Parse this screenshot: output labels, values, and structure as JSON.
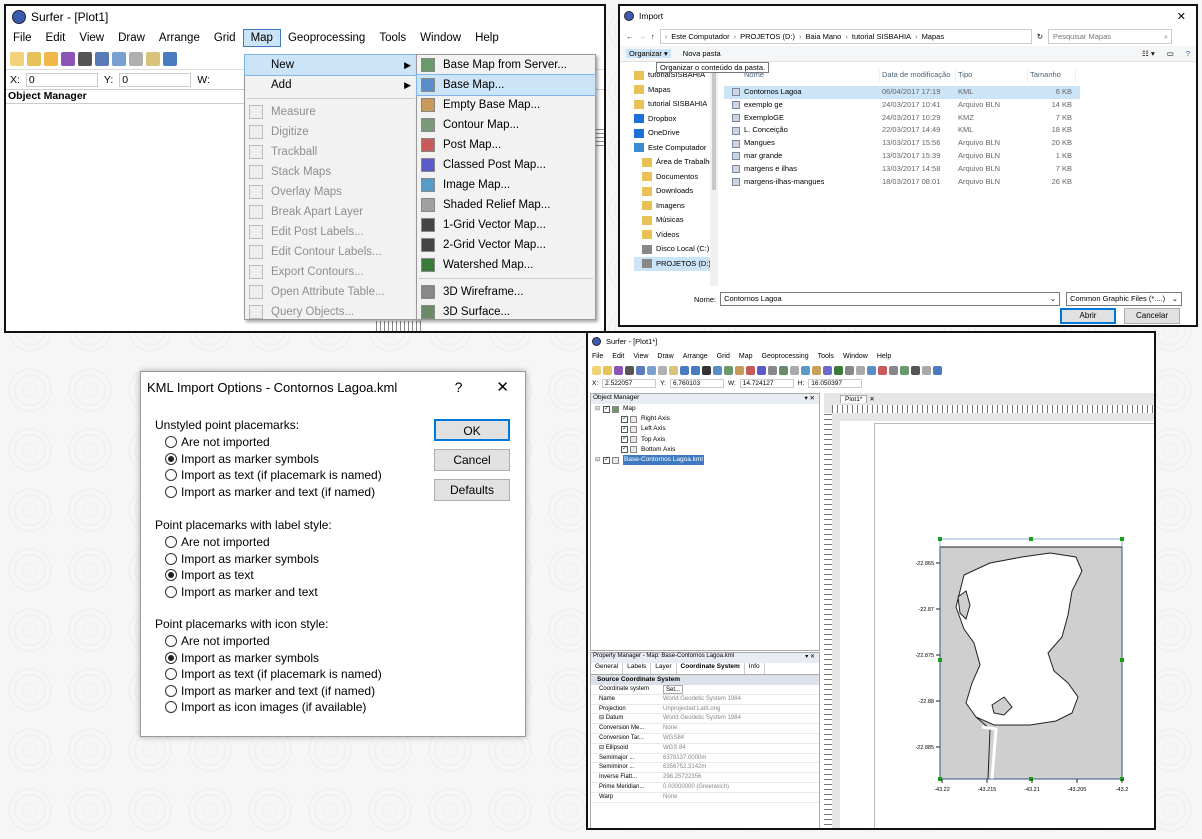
{
  "surfer_menu": {
    "title": "Surfer - [Plot1]",
    "menubar": [
      "File",
      "Edit",
      "View",
      "Draw",
      "Arrange",
      "Grid",
      "Map",
      "Geoprocessing",
      "Tools",
      "Window",
      "Help"
    ],
    "coords": {
      "x_label": "X:",
      "x_val": "0",
      "y_label": "Y:",
      "y_val": "0",
      "w_label": "W:"
    },
    "object_manager": "Object Manager",
    "map_menu": {
      "new": "New",
      "add": "Add",
      "items": [
        "Measure",
        "Digitize",
        "Trackball",
        "Stack Maps",
        "Overlay Maps",
        "Break Apart Layer",
        "Edit Post Labels...",
        "Edit Contour Labels...",
        "Export Contours...",
        "Open Attribute Table...",
        "Query Objects..."
      ]
    },
    "new_submenu": [
      "Base Map from Server...",
      "Base Map...",
      "Empty Base Map...",
      "Contour Map...",
      "Post Map...",
      "Classed Post Map...",
      "Image Map...",
      "Shaded Relief Map...",
      "1-Grid Vector Map...",
      "2-Grid Vector Map...",
      "Watershed Map...",
      "3D Wireframe...",
      "3D Surface..."
    ]
  },
  "import_dialog": {
    "title": "Import",
    "path": [
      "Este Computador",
      "PROJETOS (D:)",
      "Baia Mano",
      "tutorial SISBAHIA",
      "Mapas"
    ],
    "search_placeholder": "Pesquisar Mapas",
    "organize": "Organizar ▾",
    "new_folder": "Nova pasta",
    "tooltip": "Organizar o conteúdo da pasta.",
    "nav": [
      "tutorialSISBAHIA",
      "Mapas",
      "tutorial SISBAHIA",
      "Dropbox",
      "OneDrive",
      "Este Computador",
      "Área de Trabalho",
      "Documentos",
      "Downloads",
      "Imagens",
      "Músicas",
      "Vídeos",
      "Disco Local (C:)",
      "PROJETOS (D:)"
    ],
    "columns": [
      "Nome",
      "Data de modificação",
      "Tipo",
      "Tamanho"
    ],
    "files": [
      {
        "name": "Contornos Lagoa",
        "date": "06/04/2017 17:19",
        "type": "KML",
        "size": "6 KB"
      },
      {
        "name": "exemplo ge",
        "date": "24/03/2017 10:41",
        "type": "Arquivo BLN",
        "size": "14 KB"
      },
      {
        "name": "ExemploGE",
        "date": "24/03/2017 10:29",
        "type": "KMZ",
        "size": "7 KB"
      },
      {
        "name": "L. Conceição",
        "date": "22/03/2017 14:49",
        "type": "KML",
        "size": "18 KB"
      },
      {
        "name": "Mangues",
        "date": "13/03/2017 15:56",
        "type": "Arquivo BLN",
        "size": "20 KB"
      },
      {
        "name": "mar grande",
        "date": "13/03/2017 15:39",
        "type": "Arquivo BLN",
        "size": "1 KB"
      },
      {
        "name": "margens e ilhas",
        "date": "13/03/2017 14:58",
        "type": "Arquivo BLN",
        "size": "7 KB"
      },
      {
        "name": "margens-ilhas-mangues",
        "date": "18/03/2017 08:01",
        "type": "Arquivo BLN",
        "size": "26 KB"
      }
    ],
    "filename_label": "Nome:",
    "filename_value": "Contornos Lagoa",
    "filter": "Common Graphic Files (*....)",
    "open": "Abrir",
    "cancel": "Cancelar"
  },
  "kml_dialog": {
    "title": "KML Import Options - Contornos Lagoa.kml",
    "help": "?",
    "close": "✕",
    "ok": "OK",
    "cancel": "Cancel",
    "defaults": "Defaults",
    "groups": [
      {
        "label": "Unstyled point placemarks:",
        "options": [
          "Are not imported",
          "Import as marker symbols",
          "Import as text (if placemark is named)",
          "Import as marker and text (if named)"
        ],
        "selected": 1
      },
      {
        "label": "Point placemarks with label style:",
        "options": [
          "Are not imported",
          "Import as marker symbols",
          "Import as text",
          "Import as marker and text"
        ],
        "selected": 2
      },
      {
        "label": "Point placemarks with icon style:",
        "options": [
          "Are not imported",
          "Import as marker symbols",
          "Import as text (if placemark is named)",
          "Import as marker and text (if named)",
          "Import as icon images (if available)"
        ],
        "selected": 1
      }
    ]
  },
  "surfer_result": {
    "title": "Surfer - [Plot1*]",
    "menubar": [
      "File",
      "Edit",
      "View",
      "Draw",
      "Arrange",
      "Grid",
      "Map",
      "Geoprocessing",
      "Tools",
      "Window",
      "Help"
    ],
    "coords": [
      "X:",
      "2.522057",
      "Y:",
      "6.760103",
      "W:",
      "14.724127",
      "H:",
      "16.050397"
    ],
    "object_manager": "Object Manager",
    "tree": [
      "Map",
      "Right Axis",
      "Left Axis",
      "Top Axis",
      "Bottom Axis",
      "Base-Contornos Lagoa.kml"
    ],
    "tab": "Plot1*",
    "prop_title": "Property Manager - Map: Base-Contornos Lagoa.kml",
    "prop_tabs": [
      "General",
      "Labels",
      "Layer",
      "Coordinate System",
      "Info"
    ],
    "prop_section": "Source Coordinate System",
    "props": [
      [
        "Coordinate system",
        "Set..."
      ],
      [
        "Name",
        "World Geodetic System 1984"
      ],
      [
        "Projection",
        "Unprojected Lat/Long"
      ],
      [
        "⊟ Datum",
        "World Geodetic System 1984"
      ],
      [
        "Conversion Me...",
        "None"
      ],
      [
        "Conversion Tar...",
        "WGS84"
      ],
      [
        "⊟ Ellipsoid",
        "WGS 84"
      ],
      [
        "Semimajor ...",
        "6378137.0000m"
      ],
      [
        "Semiminor ...",
        "6356752.3142m"
      ],
      [
        "Inverse Flatt...",
        "298.25722356"
      ],
      [
        "Prime Meridian...",
        "0.00000000 (Greenwich)"
      ],
      [
        "Warp",
        "None"
      ]
    ],
    "y_ticks": [
      "-22.865",
      "-22.87",
      "-22.875",
      "-22.88",
      "-22.885"
    ],
    "x_ticks": [
      "-43.22",
      "-43.215",
      "-43.21",
      "-43.205",
      "-43.2"
    ]
  },
  "colors": {
    "highlight": "#cce4f7",
    "accent": "#0078d7",
    "map_fill": "#d3d3d3"
  }
}
